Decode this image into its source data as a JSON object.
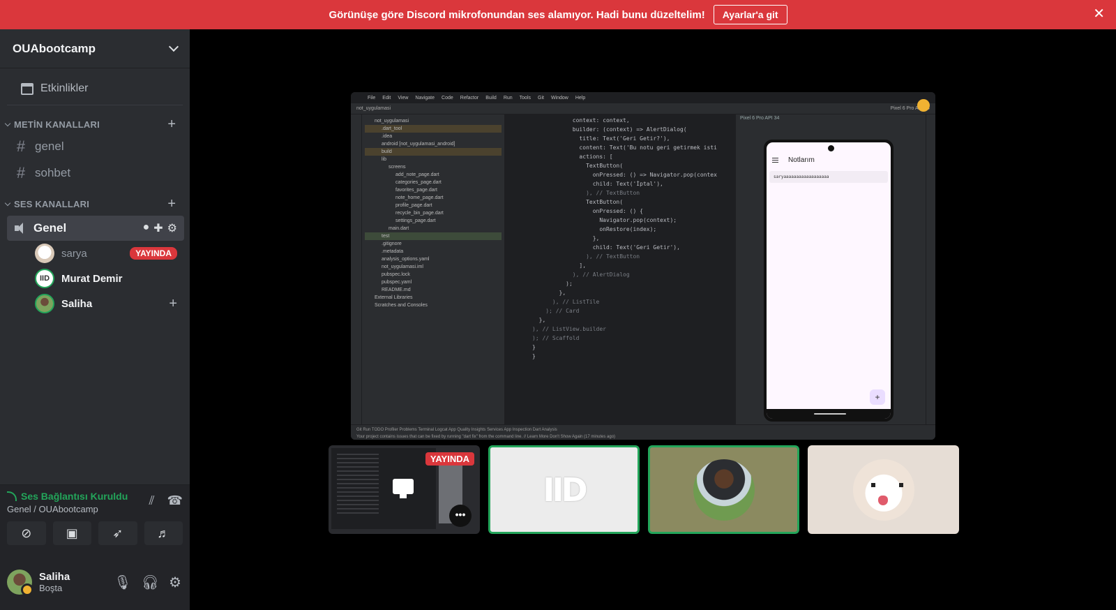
{
  "banner": {
    "message": "Görünüşe göre Discord mikrofonundan ses alamıyor. Hadi bunu düzeltelim!",
    "button": "Ayarlar'a git",
    "close": "✕"
  },
  "server": {
    "name": "OUAbootcamp",
    "events_label": "Etkinlikler"
  },
  "text_category": {
    "label": "METİN KANALLARI",
    "channels": [
      "genel",
      "sohbet"
    ]
  },
  "voice_category": {
    "label": "SES KANALLARI",
    "channel": "Genel",
    "members": [
      {
        "name": "sarya",
        "badge": "YAYINDA"
      },
      {
        "name": "Murat Demir",
        "badge": ""
      },
      {
        "name": "Saliha",
        "badge": ""
      }
    ]
  },
  "voice_panel": {
    "status": "Ses Bağlantısı Kuruldu",
    "location": "Genel / OUAbootcamp"
  },
  "user": {
    "name": "Saliha",
    "status": "Boşta"
  },
  "ide": {
    "menu": [
      "File",
      "Edit",
      "View",
      "Navigate",
      "Code",
      "Refactor",
      "Build",
      "Run",
      "Tools",
      "Git",
      "Window",
      "Help"
    ],
    "project": "not_uygulamasi",
    "tree": [
      "not_uygulamasi",
      ".dart_tool",
      ".idea",
      "android [not_uygulamasi_android]",
      "build",
      "lib",
      "screens",
      "add_note_page.dart",
      "categories_page.dart",
      "favorites_page.dart",
      "note_home_page.dart",
      "profile_page.dart",
      "recycle_bin_page.dart",
      "settings_page.dart",
      "main.dart",
      "test",
      ".gitignore",
      ".metadata",
      "analysis_options.yaml",
      "not_uygulamasi.iml",
      "pubspec.lock",
      "pubspec.yaml",
      "README.md",
      "External Libraries",
      "Scratches and Consoles"
    ],
    "code": [
      "            context: context,",
      "            builder: (context) => AlertDialog(",
      "              title: Text('Geri Getir?'),",
      "              content: Text('Bu notu geri getirmek isti",
      "              actions: [",
      "                TextButton(",
      "                  onPressed: () => Navigator.pop(contex",
      "                  child: Text('İptal'),",
      "                ), // TextButton",
      "                TextButton(",
      "                  onPressed: () {",
      "                    Navigator.pop(context);",
      "                    onRestore(index);",
      "                  },",
      "                  child: Text('Geri Getir'),",
      "                ), // TextButton",
      "              ],",
      "            ), // AlertDialog",
      "          );",
      "        },",
      "      ), // ListTile",
      "    ); // Card",
      "  },",
      "), // ListView.builder",
      "); // Scaffold",
      "}",
      "}"
    ],
    "device": "Pixel 6 Pro API 34",
    "phone_title": "Notlarım",
    "phone_note": "saryaaaaaaaaaaaaaaaaaa",
    "status_line": "Your project contains issues that can be fixed by running \"dart fix\" from the command line. // Learn More  Don't Show Again (17 minutes ago)",
    "tool_tabs": "Git  Run  TODO  Profiler  Problems  Terminal  Logcat  App Quality Insights  Services  App Inspection  Dart Analysis"
  },
  "tiles": {
    "stream_badge": "YAYINDA",
    "more": "•••"
  }
}
